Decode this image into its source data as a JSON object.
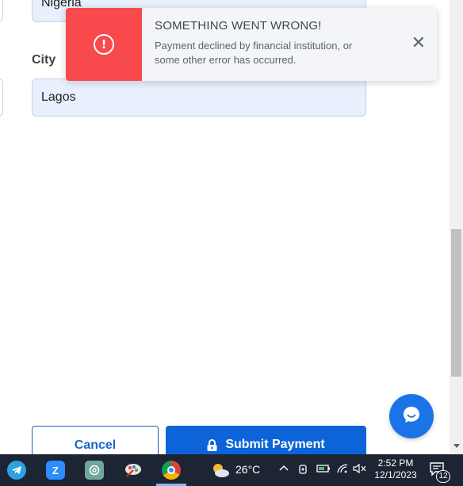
{
  "form": {
    "country_value": "Nigeria",
    "city_label": "City",
    "city_value": "Lagos"
  },
  "toast": {
    "icon": "alert-circle-icon",
    "title": "SOMETHING WENT WRONG!",
    "message": "Payment declined by financial institution, or some other error has occurred.",
    "close_icon": "close-icon",
    "accent_color": "#f84a4d"
  },
  "actions": {
    "cancel_label": "Cancel",
    "submit_label": "Submit Payment",
    "submit_color": "#0d64d8"
  },
  "chat": {
    "icon": "chat-bubble-icon"
  },
  "taskbar": {
    "apps": [
      "telegram-icon",
      "zoom-icon",
      "chatgpt-icon",
      "paint-icon",
      "chrome-icon"
    ],
    "weather": {
      "temperature": "26°C"
    },
    "clock": {
      "time": "2:52 PM",
      "date": "12/1/2023"
    },
    "notifications": {
      "count": "12"
    }
  }
}
